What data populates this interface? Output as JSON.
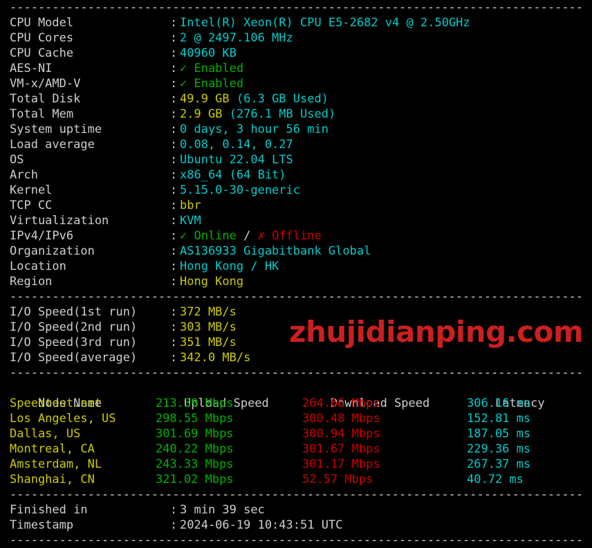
{
  "terminal": {
    "divider": "-------------------------------------------------------------------------",
    "colon": ":"
  },
  "system_info": {
    "rows": [
      {
        "label": "CPU Model",
        "value": "Intel(R) Xeon(R) CPU E5-2682 v4 @ 2.50GHz",
        "color": "cyan"
      },
      {
        "label": "CPU Cores",
        "value": "2 @ 2497.106 MHz",
        "color": "cyan"
      },
      {
        "label": "CPU Cache",
        "value": "40960 KB",
        "color": "cyan"
      },
      {
        "label": "AES-NI",
        "value": "✓ Enabled",
        "color": "green"
      },
      {
        "label": "VM-x/AMD-V",
        "value": "✓ Enabled",
        "color": "green"
      },
      {
        "label": "Total Disk",
        "value": "49.9 GB",
        "value2": " (6.3 GB Used)",
        "color": "yellow",
        "color2": "cyan"
      },
      {
        "label": "Total Mem",
        "value": "2.9 GB",
        "value2": " (276.1 MB Used)",
        "color": "yellow",
        "color2": "cyan"
      },
      {
        "label": "System uptime",
        "value": "0 days, 3 hour 56 min",
        "color": "cyan"
      },
      {
        "label": "Load average",
        "value": "0.08, 0.14, 0.27",
        "color": "cyan"
      },
      {
        "label": "OS",
        "value": "Ubuntu 22.04 LTS",
        "color": "cyan"
      },
      {
        "label": "Arch",
        "value": "x86_64 (64 Bit)",
        "color": "cyan"
      },
      {
        "label": "Kernel",
        "value": "5.15.0-30-generic",
        "color": "cyan"
      },
      {
        "label": "TCP CC",
        "value": "bbr",
        "color": "yellow"
      },
      {
        "label": "Virtualization",
        "value": "KVM",
        "color": "cyan"
      },
      {
        "label": "IPv4/IPv6",
        "value": "✓ Online",
        "value2": " / ",
        "value3": "✗ Offline",
        "color": "green",
        "color2": "white",
        "color3": "red"
      },
      {
        "label": "Organization",
        "value": "AS136933 Gigabitbank Global",
        "color": "cyan"
      },
      {
        "label": "Location",
        "value": "Hong Kong / HK",
        "color": "cyan"
      },
      {
        "label": "Region",
        "value": "Hong Kong",
        "color": "yellow"
      }
    ]
  },
  "io_speed": {
    "rows": [
      {
        "label": "I/O Speed(1st run)",
        "value": "372 MB/s",
        "color": "yellow"
      },
      {
        "label": "I/O Speed(2nd run)",
        "value": "303 MB/s",
        "color": "yellow"
      },
      {
        "label": "I/O Speed(3rd run)",
        "value": "351 MB/s",
        "color": "yellow"
      },
      {
        "label": "I/O Speed(average)",
        "value": "342.0 MB/s",
        "color": "yellow"
      }
    ]
  },
  "watermark": {
    "text": "zhujidianping.com",
    "color": "#cc1f20"
  },
  "speedtest": {
    "headers": {
      "node": "Node Name",
      "upload": "Upload Speed",
      "download": "Download Speed",
      "latency": "Latency"
    },
    "rows": [
      {
        "node": "Speedtest.net",
        "upload": "213.39 Mbps",
        "download": "264.66 Mbps",
        "latency": "306.16 ms"
      },
      {
        "node": "Los Angeles, US",
        "upload": "298.55 Mbps",
        "download": "300.48 Mbps",
        "latency": "152.81 ms"
      },
      {
        "node": "Dallas, US",
        "upload": "301.69 Mbps",
        "download": "300.94 Mbps",
        "latency": "187.05 ms"
      },
      {
        "node": "Montreal, CA",
        "upload": "240.22 Mbps",
        "download": "301.67 Mbps",
        "latency": "229.36 ms"
      },
      {
        "node": "Amsterdam, NL",
        "upload": "243.33 Mbps",
        "download": "301.17 Mbps",
        "latency": "267.37 ms"
      },
      {
        "node": "Shanghai, CN",
        "upload": "321.02 Mbps",
        "download": "52.57 Mbps",
        "latency": "40.72 ms"
      }
    ]
  },
  "footer": {
    "rows": [
      {
        "label": "Finished in",
        "value": "3 min 39 sec",
        "color": "white"
      },
      {
        "label": "Timestamp",
        "value": "2024-06-19 10:43:51 UTC",
        "color": "white"
      }
    ]
  }
}
